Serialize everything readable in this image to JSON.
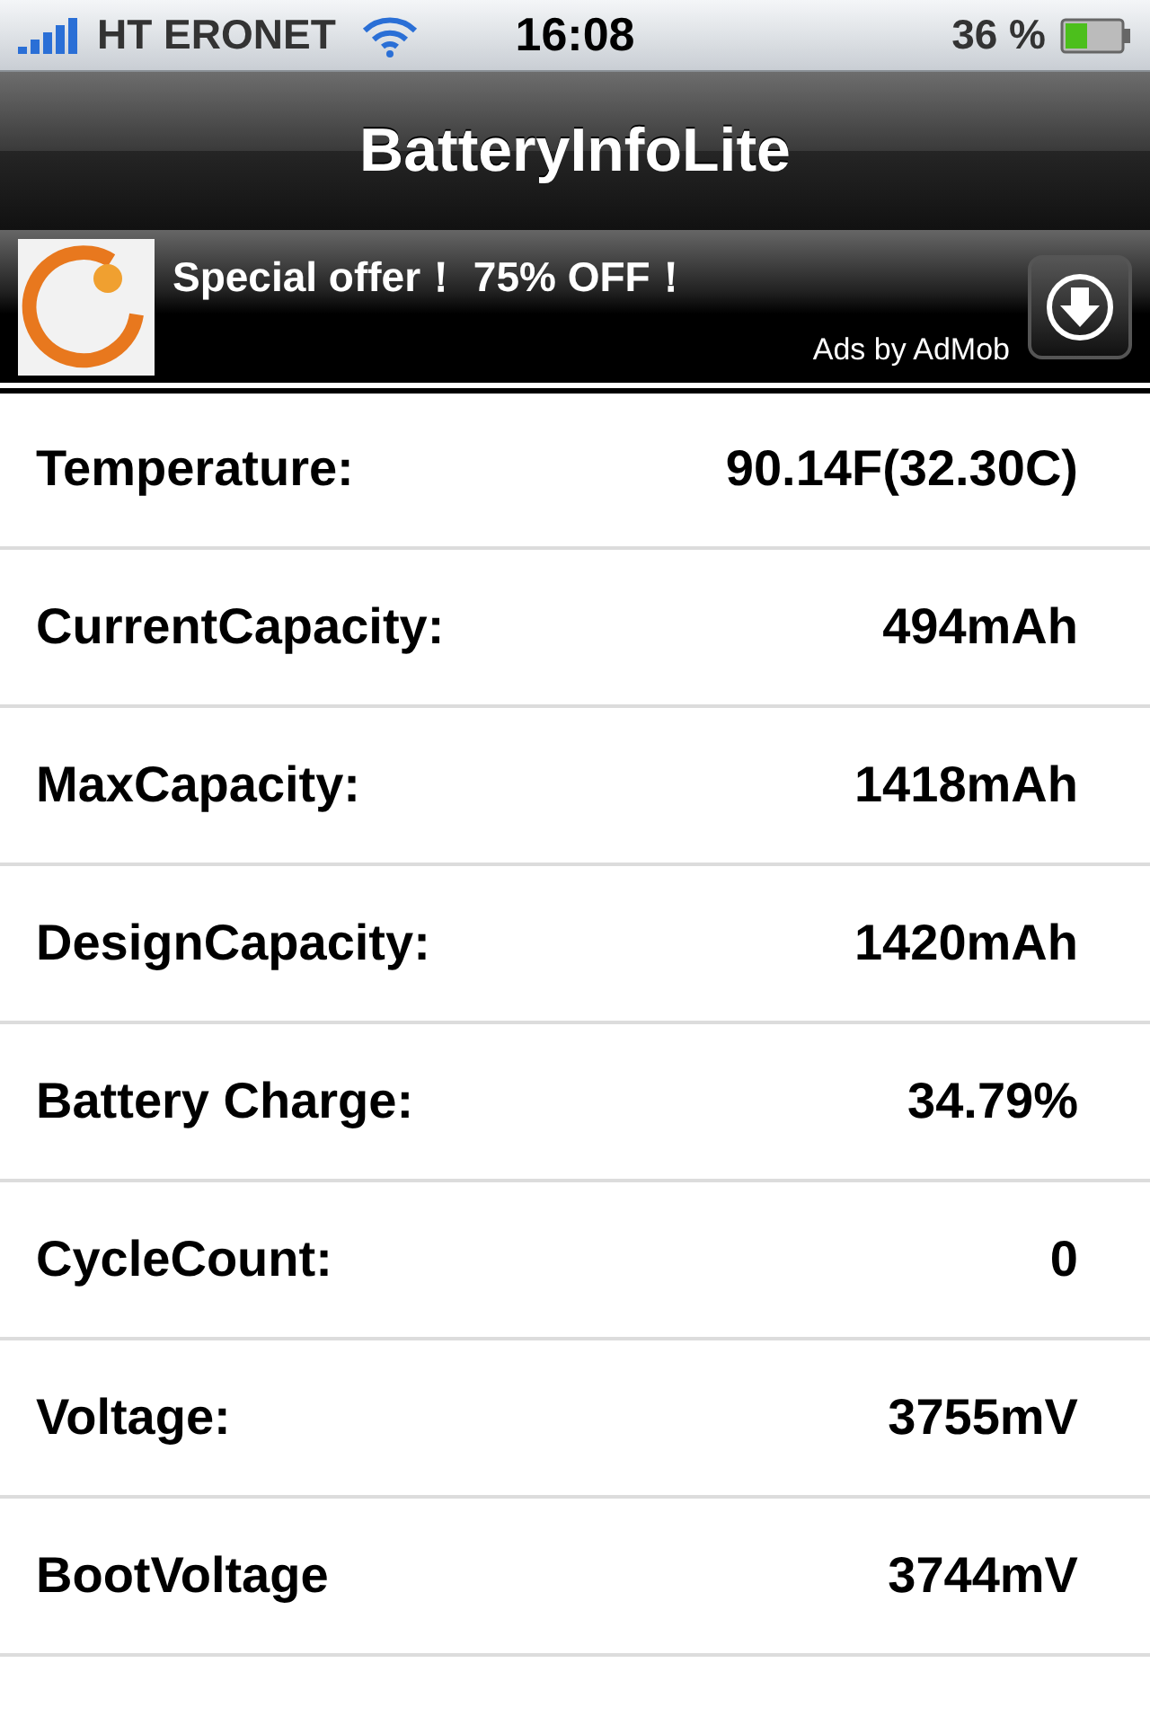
{
  "status_bar": {
    "carrier": "HT ERONET",
    "time": "16:08",
    "battery": "36 %"
  },
  "nav_bar": {
    "title": "BatteryInfoLite"
  },
  "ad": {
    "headline": "Special offer！ 75% OFF！",
    "attribution": "Ads by AdMob"
  },
  "rows": [
    {
      "label": "Temperature:",
      "value": "90.14F(32.30C)"
    },
    {
      "label": "CurrentCapacity:",
      "value": "494mAh"
    },
    {
      "label": "MaxCapacity:",
      "value": "1418mAh"
    },
    {
      "label": "DesignCapacity:",
      "value": "1420mAh"
    },
    {
      "label": "Battery Charge:",
      "value": "34.79%"
    },
    {
      "label": "CycleCount:",
      "value": "0"
    },
    {
      "label": "Voltage:",
      "value": "3755mV"
    },
    {
      "label": "BootVoltage",
      "value": "3744mV"
    }
  ]
}
